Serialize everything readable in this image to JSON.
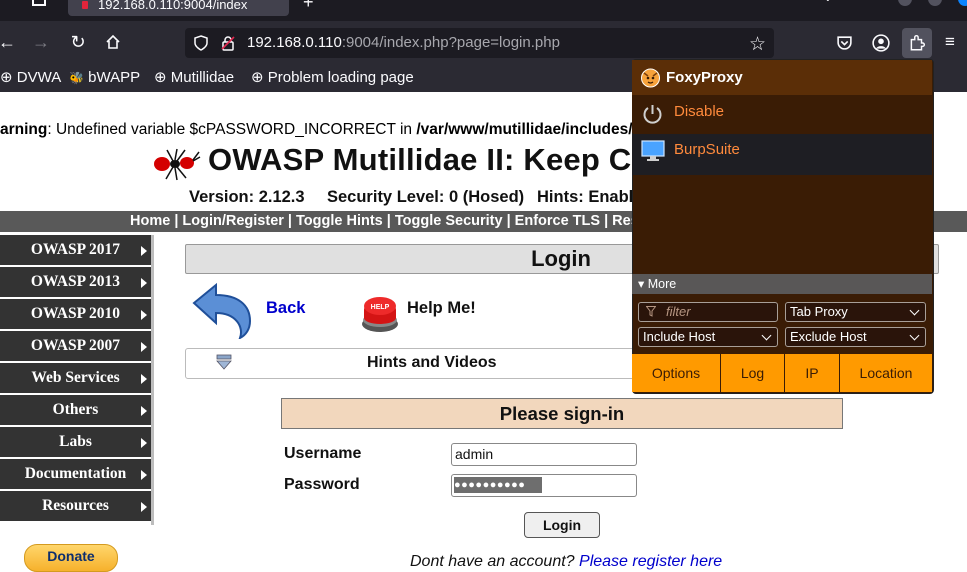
{
  "browser": {
    "tab_title": "192.168.0.110:9004/index",
    "url_host": "192.168.0.110",
    "url_rest": ":9004/index.php?page=login.php",
    "bookmarks": [
      "DVWA",
      "bWAPP",
      "Mutillidae",
      "Problem loading page"
    ]
  },
  "page": {
    "warning_label": "arning",
    "warning_text": ": Undefined variable $cPASSWORD_INCORRECT in ",
    "warning_path": "/var/www/mutillidae/includes/p",
    "site_title": "OWASP Mutillidae II: Keep Calm",
    "version": "Version: 2.12.3",
    "security_level": "Security Level: 0 (Hosed)",
    "hints": "Hints: Enable",
    "menu": "Home | Login/Register | Toggle Hints | Toggle Security | Enforce TLS | Reset DB |",
    "sidebar": [
      "OWASP 2017",
      "OWASP 2013",
      "OWASP 2010",
      "OWASP 2007",
      "Web Services",
      "Others",
      "Labs",
      "Documentation",
      "Resources"
    ],
    "donate": "Donate",
    "login_title": "Login",
    "back": "Back",
    "help": "Help Me!",
    "hints_videos": "Hints and Videos",
    "signin_title": "Please sign-in",
    "username_label": "Username",
    "password_label": "Password",
    "username_value": "admin",
    "password_mask": "●●●●●●●●●●",
    "login_button": "Login",
    "register_prefix": "Dont have an account? ",
    "register_link": "Please register here"
  },
  "foxyproxy": {
    "title": "FoxyProxy",
    "disable": "Disable",
    "proxy": "BurpSuite",
    "more": "▾ More",
    "filter_placeholder": "filter",
    "tab_proxy": "Tab Proxy",
    "include_host": "Include Host",
    "exclude_host": "Exclude Host",
    "buttons": [
      "Options",
      "Log",
      "IP",
      "Location"
    ]
  },
  "colors": {
    "menu_bar": "#595959",
    "sidebar": "#333333",
    "foxy_accent": "#ff9a00",
    "foxy_text": "#ff8a3c"
  }
}
